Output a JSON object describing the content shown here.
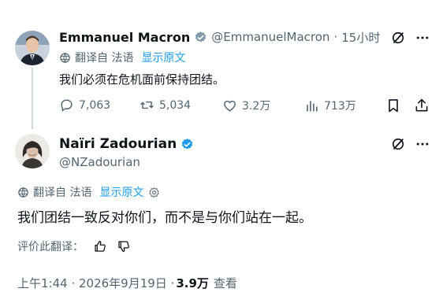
{
  "tweet1": {
    "author_name": "Emmanuel Macron",
    "handle": "@EmmanuelMacron",
    "separator": "·",
    "time": "15小时",
    "translated_from": "翻译自 法语",
    "show_original": "显示原文",
    "text": "我们必须在危机面前保持团结。",
    "stats": {
      "replies": "7,063",
      "retweets": "5,034",
      "likes": "3.2万",
      "views": "713万"
    }
  },
  "tweet2": {
    "author_name": "Naïri Zadourian",
    "handle": "@NZadourian",
    "translated_from": "翻译自 法语",
    "show_original": "显示原文",
    "text": "我们团结一致反对你们，而不是与你们站在一起。",
    "rate_translation": "评价此翻译：",
    "timestamp": "上午1:44 · 2026年9月19日 · ",
    "views_count": "3.9万",
    "views_label": "查看"
  },
  "icons": [
    "verified-badge-icon",
    "grok-icon",
    "more-icon",
    "translate-icon",
    "reply-icon",
    "retweet-icon",
    "like-icon",
    "views-icon",
    "bookmark-icon",
    "share-icon",
    "settings-icon",
    "thumbs-up-icon",
    "thumbs-down-icon"
  ],
  "colors": {
    "accent": "#1d9bf0",
    "text": "#0f1419",
    "muted": "#536471",
    "thread_line": "#cfd9de"
  }
}
